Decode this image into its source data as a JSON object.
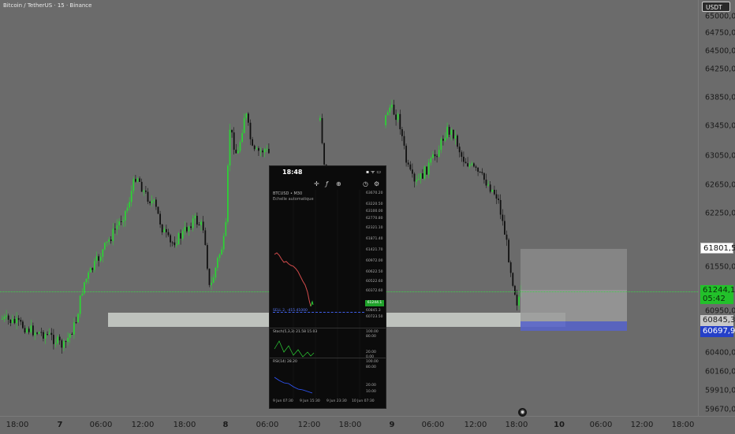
{
  "header": {
    "title": "Bitcoin / TetherUS · 15 · Binance",
    "currency": "USDT"
  },
  "price_axis": {
    "ticks": [
      "65000,0",
      "64750,0",
      "64500,0",
      "64250,0",
      "63850,0",
      "63450,0",
      "63050,0",
      "62650,0",
      "62250,0",
      "61801,5",
      "61550,0",
      "61244,1",
      "60950,0",
      "60845,3",
      "60697,9",
      "60400,0",
      "60160,0",
      "59910,0",
      "59670,0"
    ],
    "labels": {
      "level_white": "61801,5",
      "current_price": "61244,1",
      "countdown": "05:42",
      "level_grey": "60845,3",
      "level_blue": "60697,9"
    }
  },
  "time_axis": {
    "ticks": [
      {
        "label": "18:00",
        "bold": false
      },
      {
        "label": "7",
        "bold": true
      },
      {
        "label": "06:00",
        "bold": false
      },
      {
        "label": "12:00",
        "bold": false
      },
      {
        "label": "18:00",
        "bold": false
      },
      {
        "label": "8",
        "bold": true
      },
      {
        "label": "06:00",
        "bold": false
      },
      {
        "label": "12:00",
        "bold": false
      },
      {
        "label": "18:00",
        "bold": false
      },
      {
        "label": "9",
        "bold": true
      },
      {
        "label": "06:00",
        "bold": false
      },
      {
        "label": "12:00",
        "bold": false
      },
      {
        "label": "18:00",
        "bold": false
      },
      {
        "label": "10",
        "bold": true
      },
      {
        "label": "06:00",
        "bold": false
      },
      {
        "label": "12:00",
        "bold": false
      },
      {
        "label": "18:00",
        "bold": false
      }
    ]
  },
  "phone": {
    "time": "18:48",
    "status": "▪ ᯤ ▭",
    "symbol": "BTCUSD • M30",
    "sub": "Echelle automatique",
    "prices": [
      "63670.20",
      "63220.50",
      "63100.00",
      "62770.80",
      "62321.10",
      "61871.40",
      "61421.70",
      "60972.00",
      "60622.50",
      "60522.60",
      "60372.60",
      "61244.1",
      "60845.3",
      "60697.9",
      "60723.50"
    ],
    "order_label": "SELL 2, -415.41000",
    "stoch_label": "Stoch(5,3,3) 21.58 15.03",
    "stoch_levels": [
      "100.00",
      "80.00",
      "20.00",
      "0.00"
    ],
    "rsi_label": "RSI(14) 28.20",
    "rsi_levels": [
      "100.00",
      "80.00",
      "20.00",
      "10.00"
    ],
    "dates": [
      "9 Jun 07:30",
      "9 Jun 15:30",
      "9 Jun 23:30",
      "10 Jun 07:30"
    ],
    "last_price": "61244.1"
  },
  "colors": {
    "up": "#2dd136",
    "down": "#111111",
    "background": "#6b6b6b",
    "blue_zone": "#5864c8"
  },
  "icons": [
    "crosshair-icon",
    "function-icon",
    "indicator-icon",
    "clock-icon",
    "settings-icon",
    "tradingview-logo-icon"
  ]
}
